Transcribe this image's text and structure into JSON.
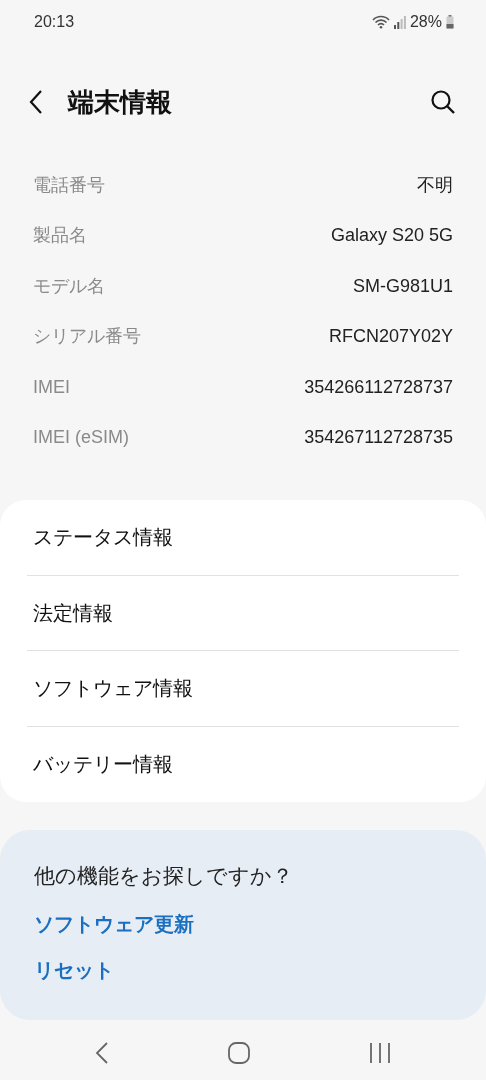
{
  "status_bar": {
    "time": "20:13",
    "battery": "28%"
  },
  "header": {
    "title": "端末情報"
  },
  "info": [
    {
      "label": "電話番号",
      "value": "不明"
    },
    {
      "label": "製品名",
      "value": "Galaxy S20 5G"
    },
    {
      "label": "モデル名",
      "value": "SM-G981U1"
    },
    {
      "label": "シリアル番号",
      "value": "RFCN207Y02Y"
    },
    {
      "label": "IMEI",
      "value": "354266112728737"
    },
    {
      "label": "IMEI (eSIM)",
      "value": "354267112728735"
    }
  ],
  "menu": [
    "ステータス情報",
    "法定情報",
    "ソフトウェア情報",
    "バッテリー情報"
  ],
  "help": {
    "title": "他の機能をお探しですか？",
    "links": [
      "ソフトウェア更新",
      "リセット"
    ]
  }
}
